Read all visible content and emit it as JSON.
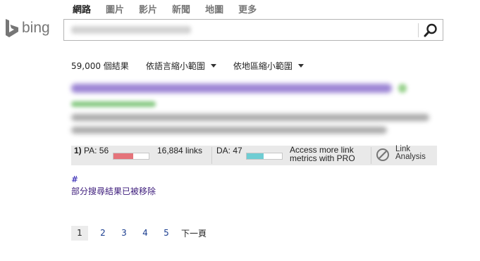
{
  "nav": {
    "tabs": [
      {
        "label": "網路",
        "active": true
      },
      {
        "label": "圖片"
      },
      {
        "label": "影片"
      },
      {
        "label": "新聞"
      },
      {
        "label": "地圖"
      },
      {
        "label": "更多"
      }
    ]
  },
  "logo": {
    "text": "bing",
    "icon": "bing-b-logo",
    "color": "#767676"
  },
  "search": {
    "query": "",
    "icon": "search-icon"
  },
  "filters": {
    "result_count": "59,000 個結果",
    "language": "依語言縮小範圍",
    "region": "依地區縮小範圍"
  },
  "mozbar": {
    "pa_prefix": "1)",
    "pa_text": "PA: 56",
    "pa_value": 56,
    "links": "16,884 links",
    "da_text": "DA: 47",
    "da_value": 47,
    "pro_line1": "Access more link",
    "pro_line2": "metrics with PRO",
    "analysis_line1": "Link",
    "analysis_line2": "Analysis",
    "analysis_icon": "compass-icon",
    "pa_color": "#e5737a",
    "da_color": "#6fcdd3"
  },
  "notice": {
    "hash": "#",
    "removed": "部分搜尋結果已被移除"
  },
  "pager": {
    "pages": [
      "1",
      "2",
      "3",
      "4",
      "5"
    ],
    "current": "1",
    "next": "下一頁"
  }
}
